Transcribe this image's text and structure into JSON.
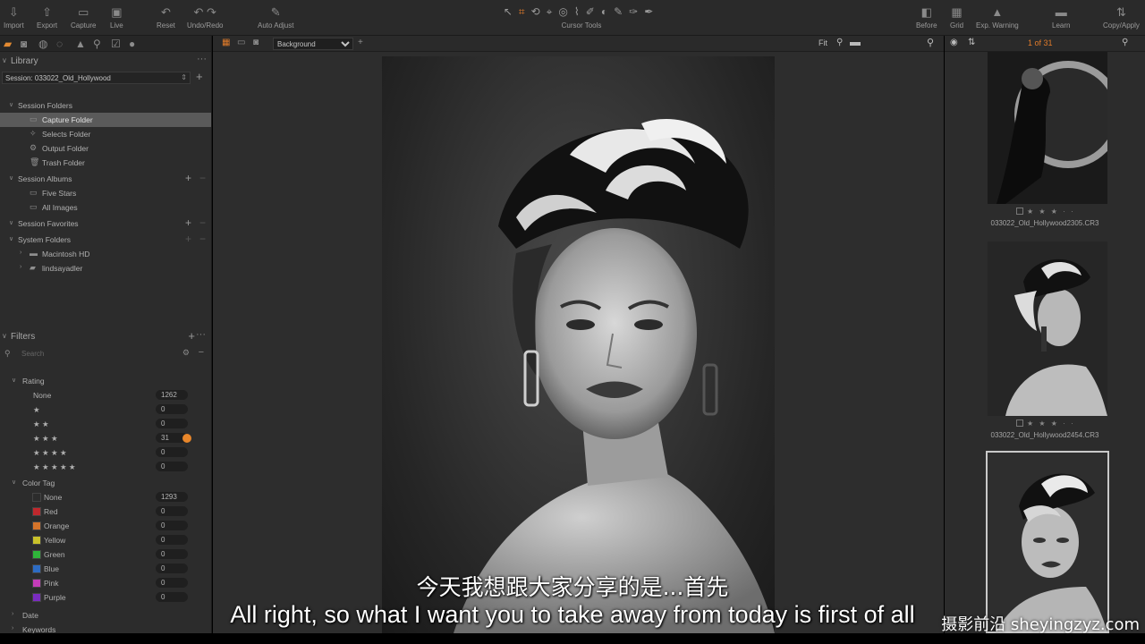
{
  "toolbar": {
    "buttons": [
      {
        "label": "Import",
        "icon": "import-icon"
      },
      {
        "label": "Export",
        "icon": "export-icon"
      },
      {
        "label": "Capture",
        "icon": "capture-icon"
      },
      {
        "label": "Live",
        "icon": "live-icon"
      },
      {
        "label": "Reset",
        "icon": "reset-icon"
      },
      {
        "label": "Undo/Redo",
        "icon": "undo-redo-icon"
      },
      {
        "label": "Auto Adjust",
        "icon": "auto-adjust-icon"
      },
      {
        "label": "Before",
        "icon": "before-icon"
      },
      {
        "label": "Grid",
        "icon": "grid-icon"
      },
      {
        "label": "Exp. Warning",
        "icon": "exposure-warning-icon"
      },
      {
        "label": "Learn",
        "icon": "learn-icon"
      },
      {
        "label": "Copy/Apply",
        "icon": "copy-apply-icon"
      }
    ],
    "cursor_tools_label": "Cursor Tools"
  },
  "library": {
    "title": "Library",
    "session": "Session: 033022_Old_Hollywood",
    "session_folders_title": "Session Folders",
    "session_folders": [
      "Capture Folder",
      "Selects Folder",
      "Output Folder",
      "Trash Folder"
    ],
    "session_albums_title": "Session Albums",
    "session_albums": [
      "Five Stars",
      "All Images"
    ],
    "session_favorites_title": "Session Favorites",
    "system_folders_title": "System Folders",
    "system_folders": [
      "Macintosh HD",
      "lindsayadler"
    ]
  },
  "filters": {
    "title": "Filters",
    "search_placeholder": "Search",
    "rating_title": "Rating",
    "ratings": [
      {
        "label": "None",
        "count": "1262"
      },
      {
        "label": "★",
        "count": "0"
      },
      {
        "label": "★ ★",
        "count": "0"
      },
      {
        "label": "★ ★ ★",
        "count": "31"
      },
      {
        "label": "★ ★ ★ ★",
        "count": "0"
      },
      {
        "label": "★ ★ ★ ★ ★",
        "count": "0"
      }
    ],
    "color_tag_title": "Color Tag",
    "color_tags": [
      {
        "label": "None",
        "count": "1293",
        "color": "#2c2c2c"
      },
      {
        "label": "Red",
        "count": "0",
        "color": "#c0282d"
      },
      {
        "label": "Orange",
        "count": "0",
        "color": "#d6742a"
      },
      {
        "label": "Yellow",
        "count": "0",
        "color": "#c9c22a"
      },
      {
        "label": "Green",
        "count": "0",
        "color": "#2fb53a"
      },
      {
        "label": "Blue",
        "count": "0",
        "color": "#2d6cc4"
      },
      {
        "label": "Pink",
        "count": "0",
        "color": "#c43cb8"
      },
      {
        "label": "Purple",
        "count": "0",
        "color": "#7a2cc0"
      }
    ],
    "date_title": "Date",
    "keywords_title": "Keywords"
  },
  "viewer": {
    "layer_select": "Background",
    "zoom_label": "Fit"
  },
  "browser": {
    "counter": "1 of 31",
    "thumbnails": [
      {
        "filename": "033022_Old_Hollywood2305.CR3",
        "stars": "★ ★ ★ · ·"
      },
      {
        "filename": "033022_Old_Hollywood2454.CR3",
        "stars": "★ ★ ★ · ·"
      }
    ]
  },
  "subtitles": {
    "chinese": "今天我想跟大家分享的是...首先",
    "english": "All right, so what I want you to take away from today is first of all",
    "watermark": "摄影前沿 sheyingzyz.com"
  },
  "colors": {
    "accent": "#e07b2a",
    "panel": "#2c2c2c",
    "selected_row": "#5a5a5a"
  }
}
